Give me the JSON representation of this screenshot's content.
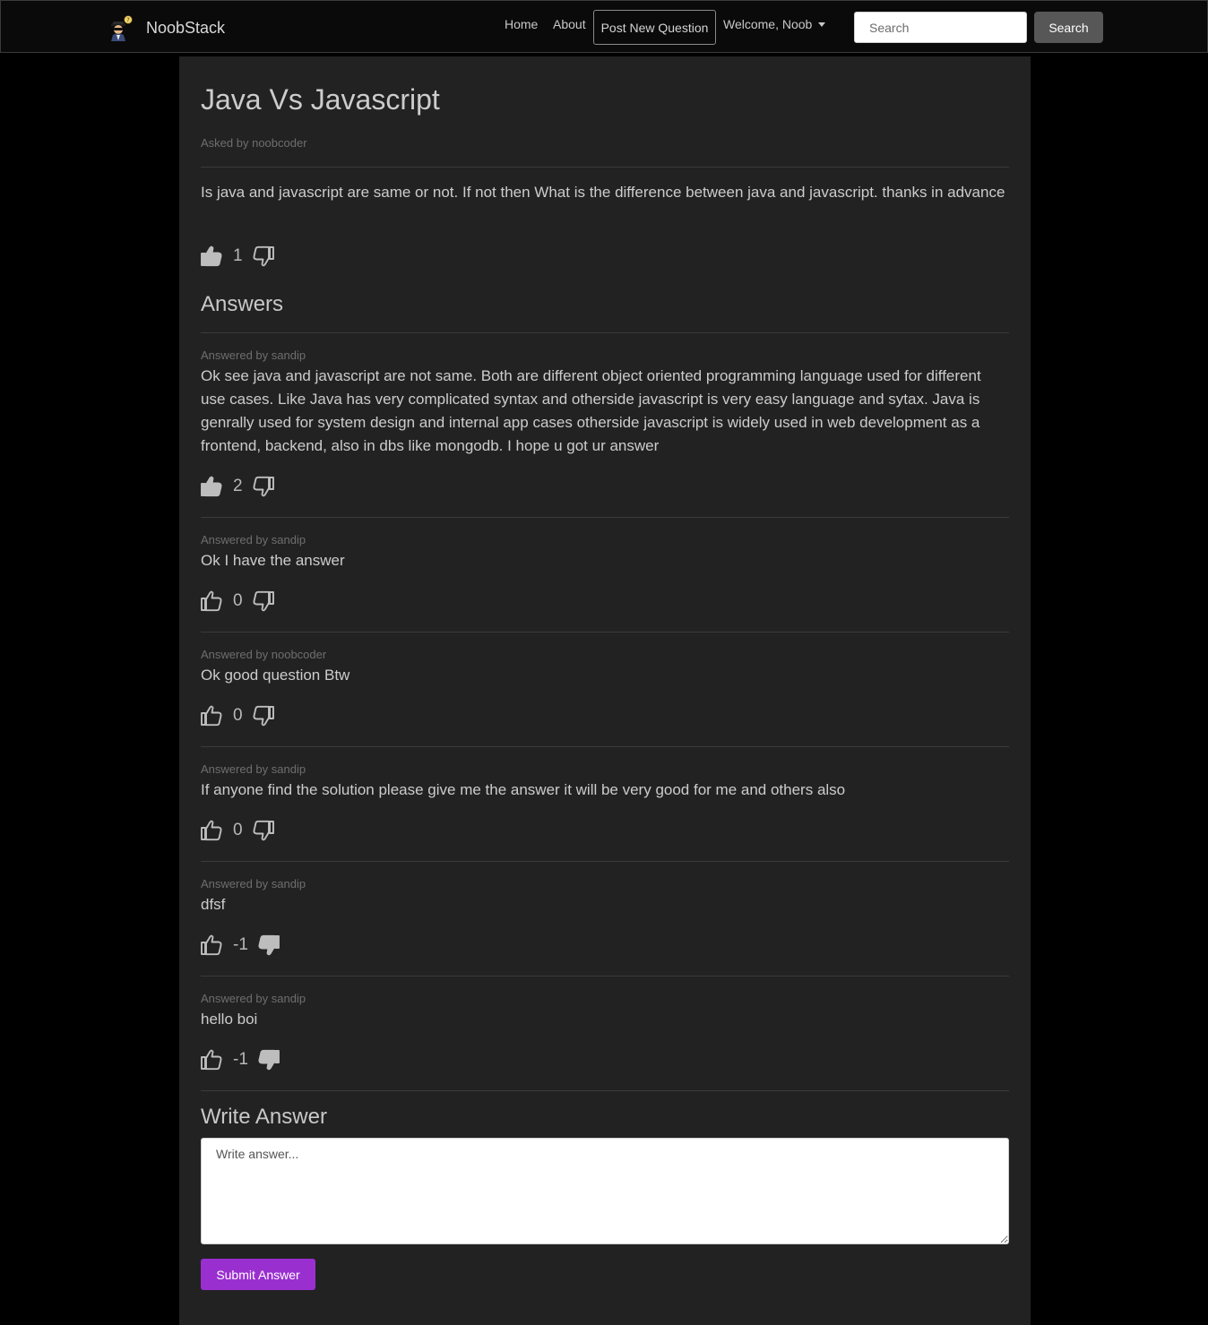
{
  "brand": {
    "name": "NoobStack",
    "logo_icon": "hacker-avatar-icon"
  },
  "nav": {
    "home": "Home",
    "about": "About",
    "post_question": "Post New Question",
    "welcome": "Welcome, Noob"
  },
  "search": {
    "placeholder": "Search",
    "button": "Search"
  },
  "question": {
    "title": "Java Vs Javascript",
    "asked_by": "Asked by noobcoder",
    "body": "Is java and javascript are same or not. If not then What is the difference between java and javascript. thanks in advance",
    "votes": "1",
    "liked": true,
    "disliked": false
  },
  "answers_heading": "Answers",
  "answers": [
    {
      "meta": "Answered by sandip",
      "body": "Ok see java and javascript are not same. Both are different object oriented programming language used for different use cases. Like Java has very complicated syntax and otherside javascript is very easy language and sytax. Java is genrally used for system design and internal app cases otherside javascript is widely used in web development as a frontend, backend, also in dbs like mongodb. I hope u got ur answer",
      "votes": "2",
      "liked": true,
      "disliked": false
    },
    {
      "meta": "Answered by sandip",
      "body": "Ok I have the answer",
      "votes": "0",
      "liked": false,
      "disliked": false
    },
    {
      "meta": "Answered by noobcoder",
      "body": "Ok good question Btw",
      "votes": "0",
      "liked": false,
      "disliked": false
    },
    {
      "meta": "Answered by sandip",
      "body": "If anyone find the solution please give me the answer it will be very good for me and others also",
      "votes": "0",
      "liked": false,
      "disliked": false
    },
    {
      "meta": "Answered by sandip",
      "body": "dfsf",
      "votes": "-1",
      "liked": false,
      "disliked": true
    },
    {
      "meta": "Answered by sandip",
      "body": "hello boi",
      "votes": "-1",
      "liked": false,
      "disliked": true
    }
  ],
  "write_answer": {
    "heading": "Write Answer",
    "placeholder": "Write answer...",
    "submit": "Submit Answer"
  },
  "colors": {
    "page_bg": "#000000",
    "panel_bg": "#222222",
    "accent": "#9a2fd0",
    "search_button": "#575757"
  }
}
